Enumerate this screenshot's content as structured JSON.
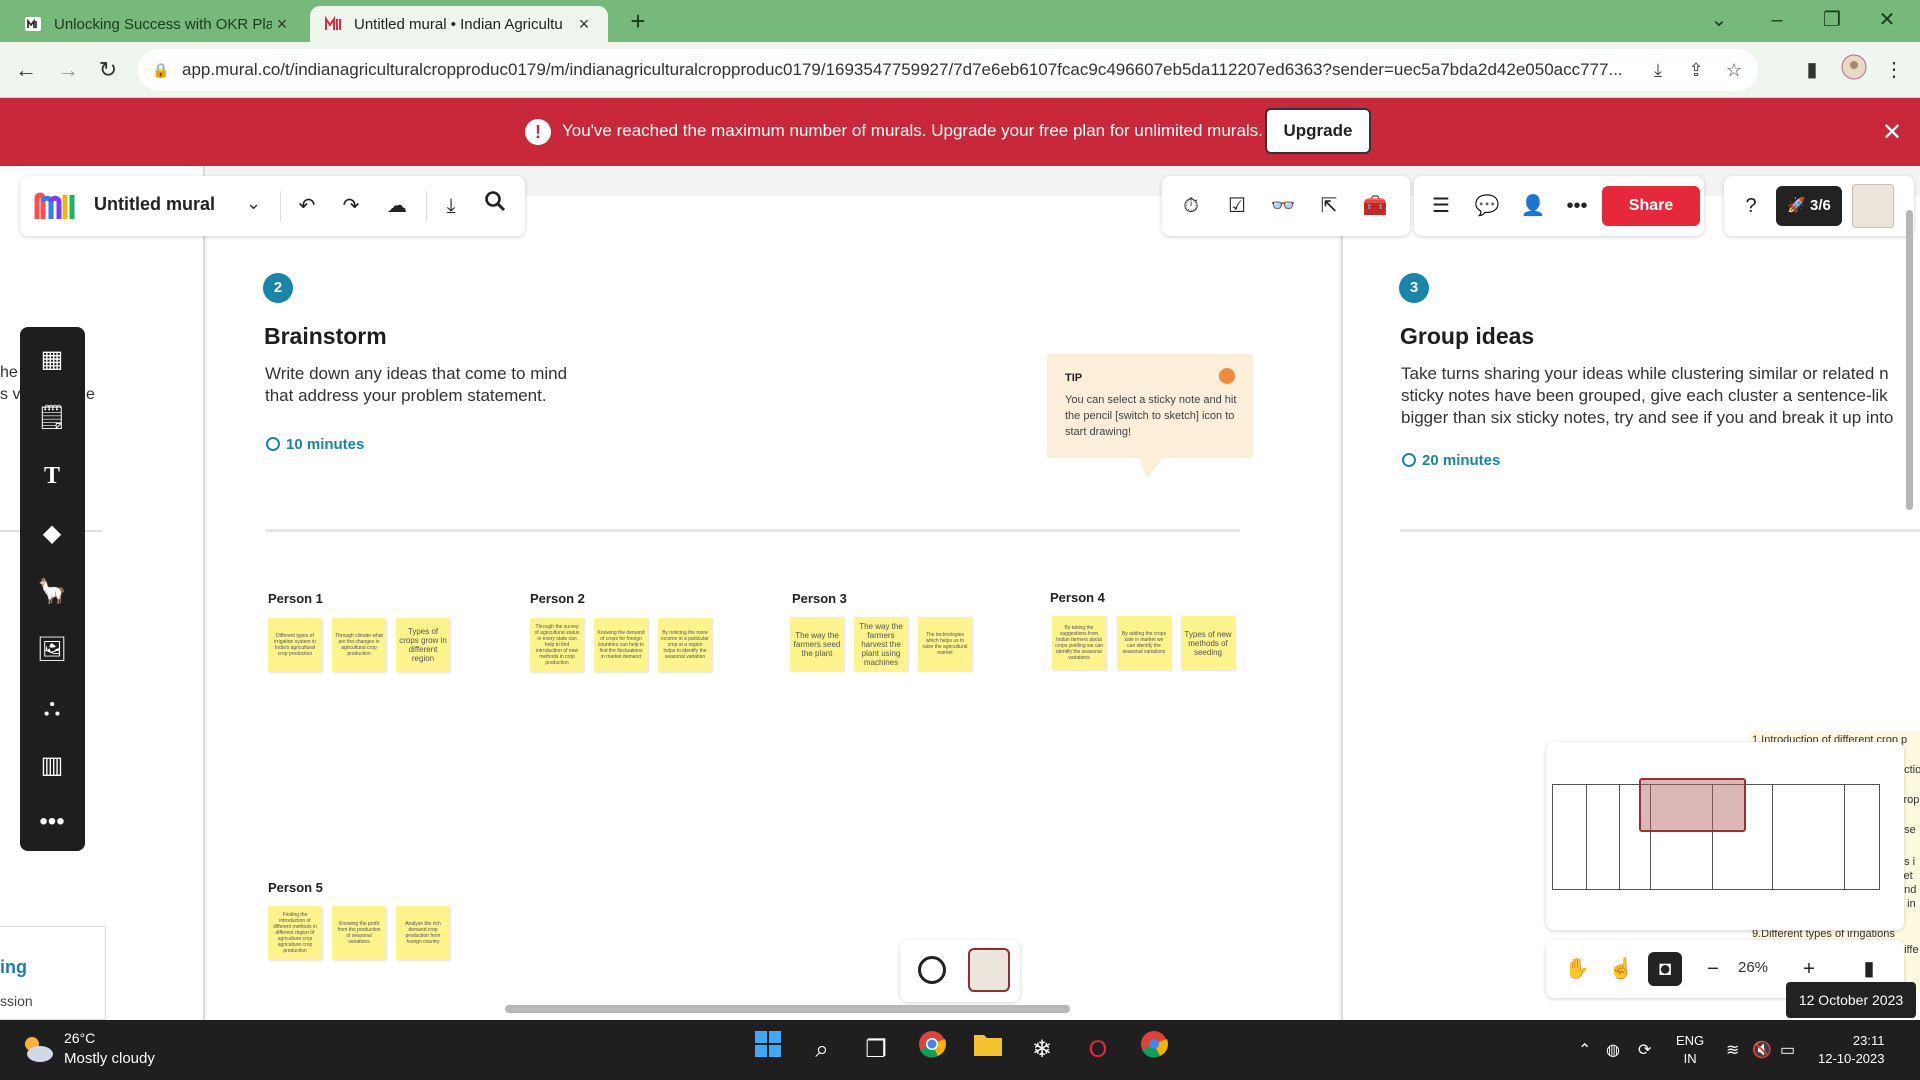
{
  "browser": {
    "tabs": [
      {
        "title": "Unlocking Success with OKR Pla",
        "active": false
      },
      {
        "title": "Untitled mural • Indian Agricultu",
        "active": true
      }
    ],
    "url": "app.mural.co/t/indianagriculturalcropproduc0179/m/indianagriculturalcropproduc0179/1693547759927/7d7e6eb6107fcac9c496607eb5da112207ed6363?sender=uec5a7bda2d42e050acc777..."
  },
  "banner": {
    "message": "You've reached the maximum number of murals. Upgrade your free plan for unlimited murals.",
    "upgrade_label": "Upgrade",
    "color": "#c8283a"
  },
  "toolbar": {
    "mural_name": "Untitled mural",
    "share_label": "Share",
    "progress_label": "3/6"
  },
  "left_board": {
    "fragments": [
      "he",
      "s v",
      "e"
    ],
    "card_title": "ing",
    "card_sub": "ssion"
  },
  "brainstorm": {
    "step": "2",
    "title": "Brainstorm",
    "desc_line1": "Write down any ideas that come to mind",
    "desc_line2": "that address your problem statement.",
    "time": "10 minutes",
    "tip_title": "TIP",
    "tip_text": "You can select a sticky note and hit the pencil [switch to sketch] icon to start drawing!",
    "persons": [
      {
        "label": "Person 1",
        "notes": [
          "Different types of irrigation system in India's agricultural crop production",
          "Through climate what are the changes in agricultural crop production",
          "Types of crops grow in different region"
        ]
      },
      {
        "label": "Person 2",
        "notes": [
          "Through the survey of agricultural status in every state can help to find introduction of new methods in crop production",
          "Knowing the demand of crops for foreign countries can help to find the fluctuations in market demand",
          "By noticing the more income in a particular crop at a region helps to identify the seasonal variation"
        ]
      },
      {
        "label": "Person 3",
        "notes": [
          "The way the farmers seed the plant",
          "The way the farmers harvest the plant using machines",
          "The technologies which helps us to raise the agricultural market"
        ]
      },
      {
        "label": "Person 4",
        "notes": [
          "By taking the suggestions from Indian farmers about crops yielding we can identify the seasonal variations",
          "By adding the crops sale in market we can identify the seasonal variations",
          "Types of new methods of seeding"
        ]
      },
      {
        "label": "Person 5",
        "notes": [
          "Finding the introduction of different methods in different region of agriculture crop agriculture crop production",
          "Knowing the profit from the production of seasonal variations",
          "Analyse the rich demand crop production from foreign country"
        ]
      }
    ]
  },
  "group_ideas": {
    "step": "3",
    "title": "Group ideas",
    "desc_line1": "Take turns sharing your ideas while clustering similar or related n",
    "desc_line2": "sticky notes have been grouped, give each cluster a sentence-lik",
    "desc_line3": "bigger than six sticky notes, try and see if you and break it up into",
    "time": "20 minutes",
    "fragments": [
      "1.Introduction of different crop p",
      "uctio",
      "crop",
      "rise",
      "us i",
      "ket",
      "and",
      "e in",
      "9.Different types of irrigations",
      "diffe"
    ]
  },
  "zoom": {
    "value": "26%",
    "tooltip": "12 October 2023"
  },
  "taskbar": {
    "temperature": "26°C",
    "weather": "Mostly cloudy",
    "lang1": "ENG",
    "lang2": "IN",
    "time": "23:11",
    "date": "12-10-2023"
  }
}
